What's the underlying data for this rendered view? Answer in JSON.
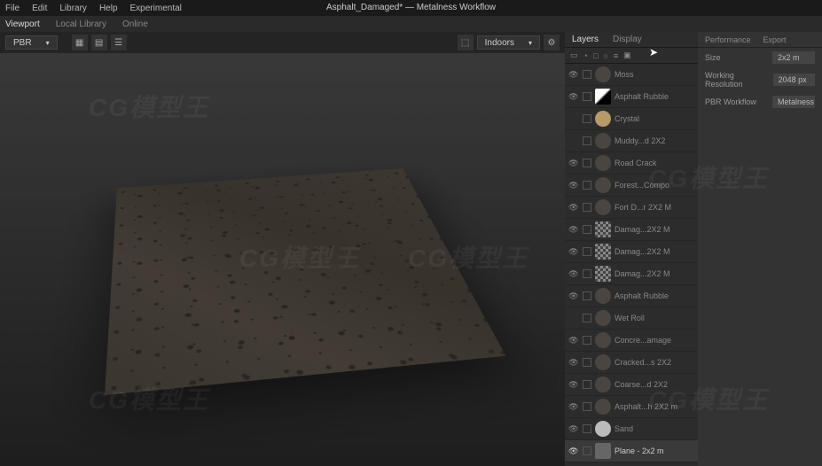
{
  "title": "Asphalt_Damaged* — Metalness Workflow",
  "menu": {
    "file": "File",
    "edit": "Edit",
    "library": "Library",
    "help": "Help",
    "experimental": "Experimental"
  },
  "tabs": {
    "viewport": "Viewport",
    "local_library": "Local Library",
    "online": "Online"
  },
  "viewport": {
    "shading": "PBR",
    "environment": "Indoors"
  },
  "right_tabs": {
    "layers": "Layers",
    "display": "Display",
    "performance": "Performance",
    "export": "Export"
  },
  "layers": [
    {
      "name": "Moss",
      "visible": true,
      "thumb": "dark"
    },
    {
      "name": "Asphalt Rubble",
      "visible": true,
      "thumb": "mask"
    },
    {
      "name": "Crystal",
      "visible": false,
      "thumb": "tan"
    },
    {
      "name": "Muddy...d 2X2",
      "visible": false,
      "thumb": "dark"
    },
    {
      "name": "Road Crack",
      "visible": true,
      "thumb": "dark"
    },
    {
      "name": "Forest...Compo",
      "visible": true,
      "thumb": "dark"
    },
    {
      "name": "Fort D...r 2X2 M",
      "visible": true,
      "thumb": "dark"
    },
    {
      "name": "Damag...2X2 M",
      "visible": true,
      "thumb": "noise"
    },
    {
      "name": "Damag...2X2 M",
      "visible": true,
      "thumb": "noise"
    },
    {
      "name": "Damag...2X2 M",
      "visible": true,
      "thumb": "noise"
    },
    {
      "name": "Asphalt Rubble",
      "visible": true,
      "thumb": "dark"
    },
    {
      "name": "Wet Roll",
      "visible": false,
      "thumb": "dark"
    },
    {
      "name": "Concre...amage",
      "visible": true,
      "thumb": "dark"
    },
    {
      "name": "Cracked...s 2X2",
      "visible": true,
      "thumb": "dark"
    },
    {
      "name": "Coarse...d 2X2",
      "visible": true,
      "thumb": "dark"
    },
    {
      "name": "Asphalt...h 2X2 m",
      "visible": true,
      "thumb": "dark"
    },
    {
      "name": "Sand",
      "visible": true,
      "thumb": "lt"
    },
    {
      "name": "Plane - 2x2 m",
      "visible": true,
      "thumb": "sq",
      "selected": true
    }
  ],
  "props": {
    "size_label": "Size",
    "size_val": "2x2 m",
    "res_label": "Working Resolution",
    "res_val": "2048 px",
    "wf_label": "PBR Workflow",
    "wf_val": "Metalness"
  },
  "watermark": "CG模型王"
}
